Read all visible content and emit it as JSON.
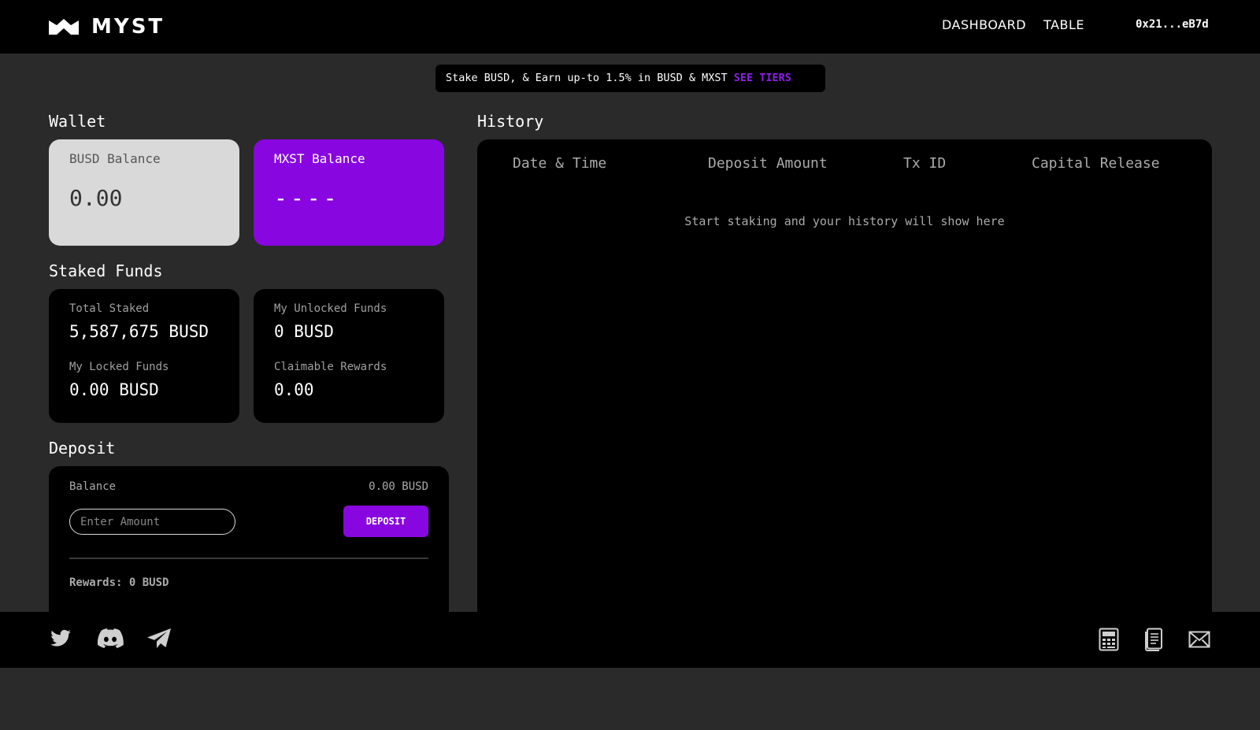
{
  "header": {
    "logo_text": "MYST",
    "nav": [
      "DASHBOARD",
      "TABLE"
    ],
    "wallet_address": "0x21...eB7d"
  },
  "banner": {
    "text": "Stake BUSD, & Earn up-to 1.5% in BUSD & MXST ",
    "link": "SEE TIERS"
  },
  "wallet": {
    "title": "Wallet",
    "busd_label": "BUSD Balance",
    "busd_value": "0.00",
    "mxst_label": "MXST Balance",
    "mxst_value": "----"
  },
  "staked": {
    "title": "Staked Funds",
    "total_label": "Total Staked",
    "total_value": "5,587,675 BUSD",
    "locked_label": "My Locked Funds",
    "locked_value": "0.00 BUSD",
    "unlocked_label": "My Unlocked Funds",
    "unlocked_value": "0 BUSD",
    "claimable_label": "Claimable Rewards",
    "claimable_value": "0.00"
  },
  "deposit": {
    "title": "Deposit",
    "balance_label": "Balance",
    "balance_value": "0.00 BUSD",
    "input_placeholder": "Enter Amount",
    "button_label": "DEPOSIT",
    "rewards_text": "Rewards: 0 BUSD"
  },
  "history": {
    "title": "History",
    "columns": [
      "Date & Time",
      "Deposit Amount",
      "Tx ID",
      "Capital Release"
    ],
    "empty_text": "Start staking and your history will show here"
  },
  "footer": {
    "social_icons": [
      "twitter-icon",
      "discord-icon",
      "telegram-icon"
    ],
    "tool_icons": [
      "calculator-icon",
      "document-icon",
      "mail-icon"
    ]
  },
  "colors": {
    "accent": "#8806e0",
    "page_bg": "#2a2a2a",
    "card_bg": "#000000",
    "light_card": "#d9d9d9"
  }
}
